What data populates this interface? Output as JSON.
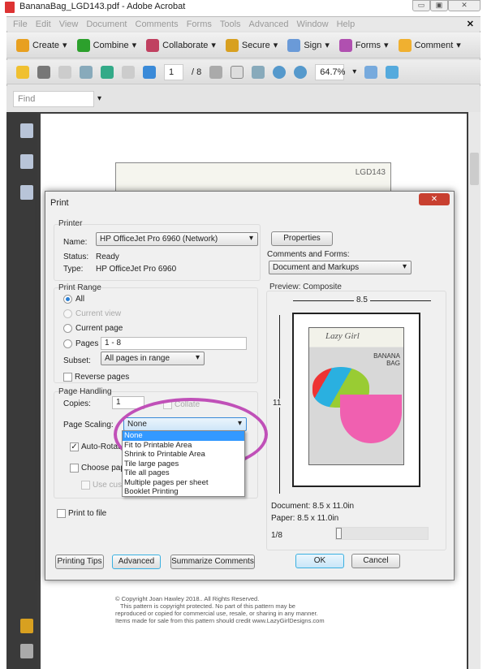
{
  "window": {
    "title": "BananaBag_LGD143.pdf - Adobe Acrobat",
    "controls": [
      "minimize",
      "restore",
      "close"
    ]
  },
  "menu": [
    "File",
    "Edit",
    "View",
    "Document",
    "Comments",
    "Forms",
    "Tools",
    "Advanced",
    "Window",
    "Help"
  ],
  "toolbar1": [
    {
      "label": "Create",
      "icon": "create-icon",
      "color": "#e8a020"
    },
    {
      "label": "Combine",
      "icon": "combine-icon",
      "color": "#2ca02c"
    },
    {
      "label": "Collaborate",
      "icon": "collaborate-icon",
      "color": "#c04060"
    },
    {
      "label": "Secure",
      "icon": "lock-icon",
      "color": "#d8a020"
    },
    {
      "label": "Sign",
      "icon": "pen-icon",
      "color": "#6a9ad8"
    },
    {
      "label": "Forms",
      "icon": "forms-icon",
      "color": "#b050b0"
    },
    {
      "label": "Comment",
      "icon": "comment-icon",
      "color": "#f0b030"
    }
  ],
  "toolbar2": {
    "page_current": "1",
    "page_total": "/ 8",
    "zoom": "64.7%"
  },
  "find": {
    "placeholder": "Find"
  },
  "page": {
    "code": "LGD143",
    "copyright": [
      "© Copyright Joan Hawley 2018.. All Rights Reserved.",
      "This pattern is copyright protected. No part of this pattern may be",
      "reproduced or copied for commercial use, resale, or sharing in any manner.",
      "Items made for sale from this pattern should credit www.LazyGirlDesigns.com"
    ]
  },
  "dialog": {
    "title": "Print",
    "printer": {
      "group": "Printer",
      "name_label": "Name:",
      "name": "HP OfficeJet Pro 6960 (Network)",
      "status_label": "Status:",
      "status": "Ready",
      "type_label": "Type:",
      "type": "HP OfficeJet Pro 6960",
      "properties": "Properties",
      "comments_label": "Comments and Forms:",
      "comments": "Document and Markups"
    },
    "range": {
      "group": "Print Range",
      "all": "All",
      "current_view": "Current view",
      "current_page": "Current page",
      "pages": "Pages",
      "pages_value": "1 - 8",
      "subset_label": "Subset:",
      "subset": "All pages in range",
      "reverse": "Reverse pages",
      "selected": "All"
    },
    "handling": {
      "group": "Page Handling",
      "copies_label": "Copies:",
      "copies": "1",
      "collate": "Collate",
      "scaling_label": "Page Scaling:",
      "scaling": "None",
      "auto_rotate": "Auto-Rotat",
      "choose_paper": "Choose pape",
      "use_custom": "Use custo",
      "options": [
        "None",
        "Fit to Printable Area",
        "Shrink to Printable Area",
        "Tile large pages",
        "Tile all pages",
        "Multiple pages per sheet",
        "Booklet Printing"
      ],
      "highlight_color": "#c050b8"
    },
    "print_to_file": "Print to file",
    "preview": {
      "group": "Preview: Composite",
      "width": "8.5",
      "height": "11",
      "document": "Document: 8.5 x 11.0in",
      "paper": "Paper: 8.5 x 11.0in",
      "page": "1/8",
      "cover_title": "BANANA BAG",
      "cover_brand": "Lazy Girl"
    },
    "buttons": {
      "tips": "Printing Tips",
      "advanced": "Advanced",
      "summarize": "Summarize Comments",
      "ok": "OK",
      "cancel": "Cancel"
    }
  }
}
